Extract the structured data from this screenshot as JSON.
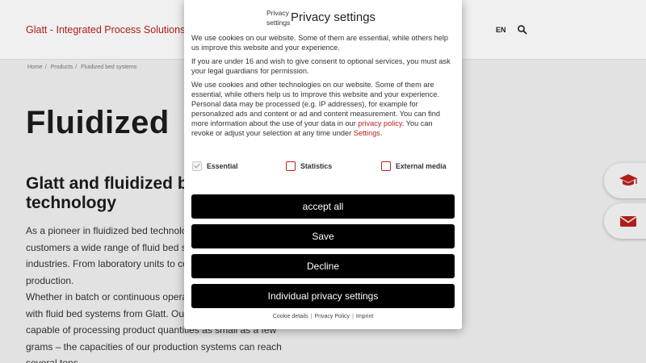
{
  "header": {
    "brand": "Glatt - Integrated Process Solutions",
    "language": "EN",
    "search_icon": "search-icon"
  },
  "breadcrumb": [
    "Home",
    "Products",
    "Fluidized bed systems"
  ],
  "page": {
    "h1": "Fluidized",
    "h2": "Glatt and fluidized bed technology",
    "para1": "As a pioneer in fluidized bed technology, we offer our customers a wide range of fluid bed systems for processing industries. From laboratory units to complex systems for production.",
    "para2": "Whether in batch or continuous operation, a lot is possible with fluid bed systems from Glatt. Our laboratory systems are capable of processing product quantities as small as a few grams – the capacities of our production systems can reach several tons."
  },
  "side_buttons": [
    {
      "icon": "graduation-cap-icon",
      "color": "#b8221c"
    },
    {
      "icon": "envelope-icon",
      "color": "#b8221c"
    }
  ],
  "modal": {
    "small_title": "Privacy settings",
    "title": "Privacy settings",
    "text1": "We use cookies on our website. Some of them are essential, while others help us improve this website and your experience.",
    "text2": "If you are under 16 and wish to give consent to optional services, you must ask your legal guardians for permission.",
    "text3_before": "We use cookies and other technologies on our website. Some of them are essential, while others help us to improve this website and your experience. Personal data may be processed (e.g. IP addresses), for example for personalized ads and content or ad and content measurement. You can find more information about the use of your data in our ",
    "text3_link1": "privacy policy",
    "text3_middle": ". You can revoke or adjust your selection at any time under ",
    "text3_link2": "Settings",
    "text3_after": ".",
    "checkboxes": [
      {
        "label": "Essential",
        "checked": true
      },
      {
        "label": "Statistics",
        "checked": false
      },
      {
        "label": "External media",
        "checked": false
      }
    ],
    "buttons": {
      "accept_all": "accept all",
      "save": "Save",
      "decline": "Decline",
      "individual": "Individual privacy settings"
    },
    "footer": {
      "cookie_details": "Cookie details",
      "privacy_policy": "Privacy Policy",
      "imprint": "Imprint",
      "separator": "|"
    }
  },
  "colors": {
    "accent": "#b8221c",
    "button_bg": "#000000",
    "button_text": "#ffffff"
  }
}
